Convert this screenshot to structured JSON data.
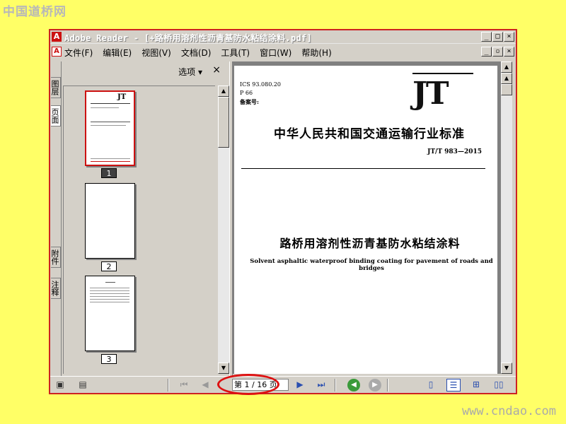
{
  "site": {
    "logo_text": "中国道桥网",
    "url": "www.cndao.com"
  },
  "window": {
    "title": "Adobe Reader - [+路桥用溶剂性沥青基防水粘结涂料.pdf]",
    "controls": {
      "minimize": "_",
      "maximize": "□",
      "close": "×"
    },
    "doc_controls": {
      "minimize": "_",
      "restore": "▫",
      "close": "×"
    }
  },
  "menubar": {
    "items": [
      {
        "label": "文件(F)"
      },
      {
        "label": "编辑(E)"
      },
      {
        "label": "视图(V)"
      },
      {
        "label": "文档(D)"
      },
      {
        "label": "工具(T)"
      },
      {
        "label": "窗口(W)"
      },
      {
        "label": "帮助(H)"
      }
    ]
  },
  "side_tabs": {
    "layers": "图层",
    "pages": "页面",
    "attachments": "附件",
    "comments": "注释"
  },
  "thumbnails_pane": {
    "options_label": "选项 ▾",
    "close_label": "×",
    "pages": [
      {
        "label": "1",
        "selected": true
      },
      {
        "label": "2",
        "selected": false
      },
      {
        "label": "3",
        "selected": false
      }
    ]
  },
  "document": {
    "ics": "ICS 93.080.20",
    "p": "P 66",
    "record": "备案号:",
    "logo": "JT",
    "standard_title": "中华人民共和国交通运输行业标准",
    "standard_number": "JT/T 983—2015",
    "title_cn": "路桥用溶剂性沥青基防水粘结涂料",
    "title_en": "Solvent asphaltic waterproof binding coating for pavement of roads and bridges"
  },
  "statusbar": {
    "page_indicator": "第 1 / 16 页",
    "current_page": 1,
    "total_pages": 16
  },
  "colors": {
    "window_border": "#cc2222",
    "background": "#ffff66",
    "highlight": "#dd1111"
  }
}
